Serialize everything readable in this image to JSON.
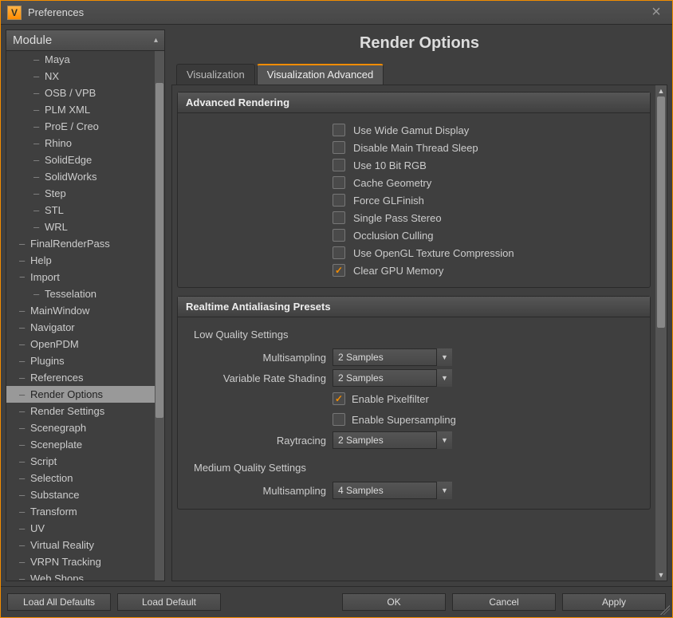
{
  "window": {
    "title": "Preferences"
  },
  "sidebar": {
    "header": "Module",
    "items": [
      {
        "label": "Maya",
        "level": 2
      },
      {
        "label": "NX",
        "level": 2
      },
      {
        "label": "OSB / VPB",
        "level": 2
      },
      {
        "label": "PLM XML",
        "level": 2
      },
      {
        "label": "ProE / Creo",
        "level": 2
      },
      {
        "label": "Rhino",
        "level": 2
      },
      {
        "label": "SolidEdge",
        "level": 2
      },
      {
        "label": "SolidWorks",
        "level": 2
      },
      {
        "label": "Step",
        "level": 2
      },
      {
        "label": "STL",
        "level": 2
      },
      {
        "label": "WRL",
        "level": 2
      },
      {
        "label": "FinalRenderPass",
        "level": 1
      },
      {
        "label": "Help",
        "level": 1
      },
      {
        "label": "Import",
        "level": 1,
        "expander": "−"
      },
      {
        "label": "Tesselation",
        "level": 2
      },
      {
        "label": "MainWindow",
        "level": 1
      },
      {
        "label": "Navigator",
        "level": 1
      },
      {
        "label": "OpenPDM",
        "level": 1
      },
      {
        "label": "Plugins",
        "level": 1
      },
      {
        "label": "References",
        "level": 1
      },
      {
        "label": "Render Options",
        "level": 1,
        "selected": true
      },
      {
        "label": "Render Settings",
        "level": 1
      },
      {
        "label": "Scenegraph",
        "level": 1
      },
      {
        "label": "Sceneplate",
        "level": 1
      },
      {
        "label": "Script",
        "level": 1
      },
      {
        "label": "Selection",
        "level": 1
      },
      {
        "label": "Substance",
        "level": 1
      },
      {
        "label": "Transform",
        "level": 1
      },
      {
        "label": "UV",
        "level": 1
      },
      {
        "label": "Virtual Reality",
        "level": 1
      },
      {
        "label": "VRPN Tracking",
        "level": 1
      },
      {
        "label": "Web Shops",
        "level": 1
      }
    ]
  },
  "page": {
    "title": "Render Options",
    "tabs": {
      "visualization": "Visualization",
      "visualization_adv": "Visualization Advanced"
    }
  },
  "advanced_rendering": {
    "header": "Advanced Rendering",
    "options": [
      {
        "label": "Use Wide Gamut Display",
        "checked": false
      },
      {
        "label": "Disable Main Thread Sleep",
        "checked": false
      },
      {
        "label": "Use 10 Bit RGB",
        "checked": false
      },
      {
        "label": "Cache Geometry",
        "checked": false
      },
      {
        "label": "Force GLFinish",
        "checked": false
      },
      {
        "label": "Single Pass Stereo",
        "checked": false
      },
      {
        "label": "Occlusion Culling",
        "checked": false
      },
      {
        "label": "Use OpenGL Texture Compression",
        "checked": false
      },
      {
        "label": "Clear GPU Memory",
        "checked": true
      }
    ]
  },
  "aa_presets": {
    "header": "Realtime Antialiasing Presets",
    "low": {
      "title": "Low Quality Settings",
      "multisampling": {
        "label": "Multisampling",
        "value": "2 Samples"
      },
      "vrs": {
        "label": "Variable Rate Shading",
        "value": "2 Samples"
      },
      "pixelfilter": {
        "label": "Enable Pixelfilter",
        "checked": true
      },
      "supersampling": {
        "label": "Enable Supersampling",
        "checked": false
      },
      "raytracing": {
        "label": "Raytracing",
        "value": "2 Samples"
      }
    },
    "medium": {
      "title": "Medium Quality Settings",
      "multisampling": {
        "label": "Multisampling",
        "value": "4 Samples"
      }
    }
  },
  "footer": {
    "load_all_defaults": "Load All Defaults",
    "load_default": "Load Default",
    "ok": "OK",
    "cancel": "Cancel",
    "apply": "Apply"
  }
}
